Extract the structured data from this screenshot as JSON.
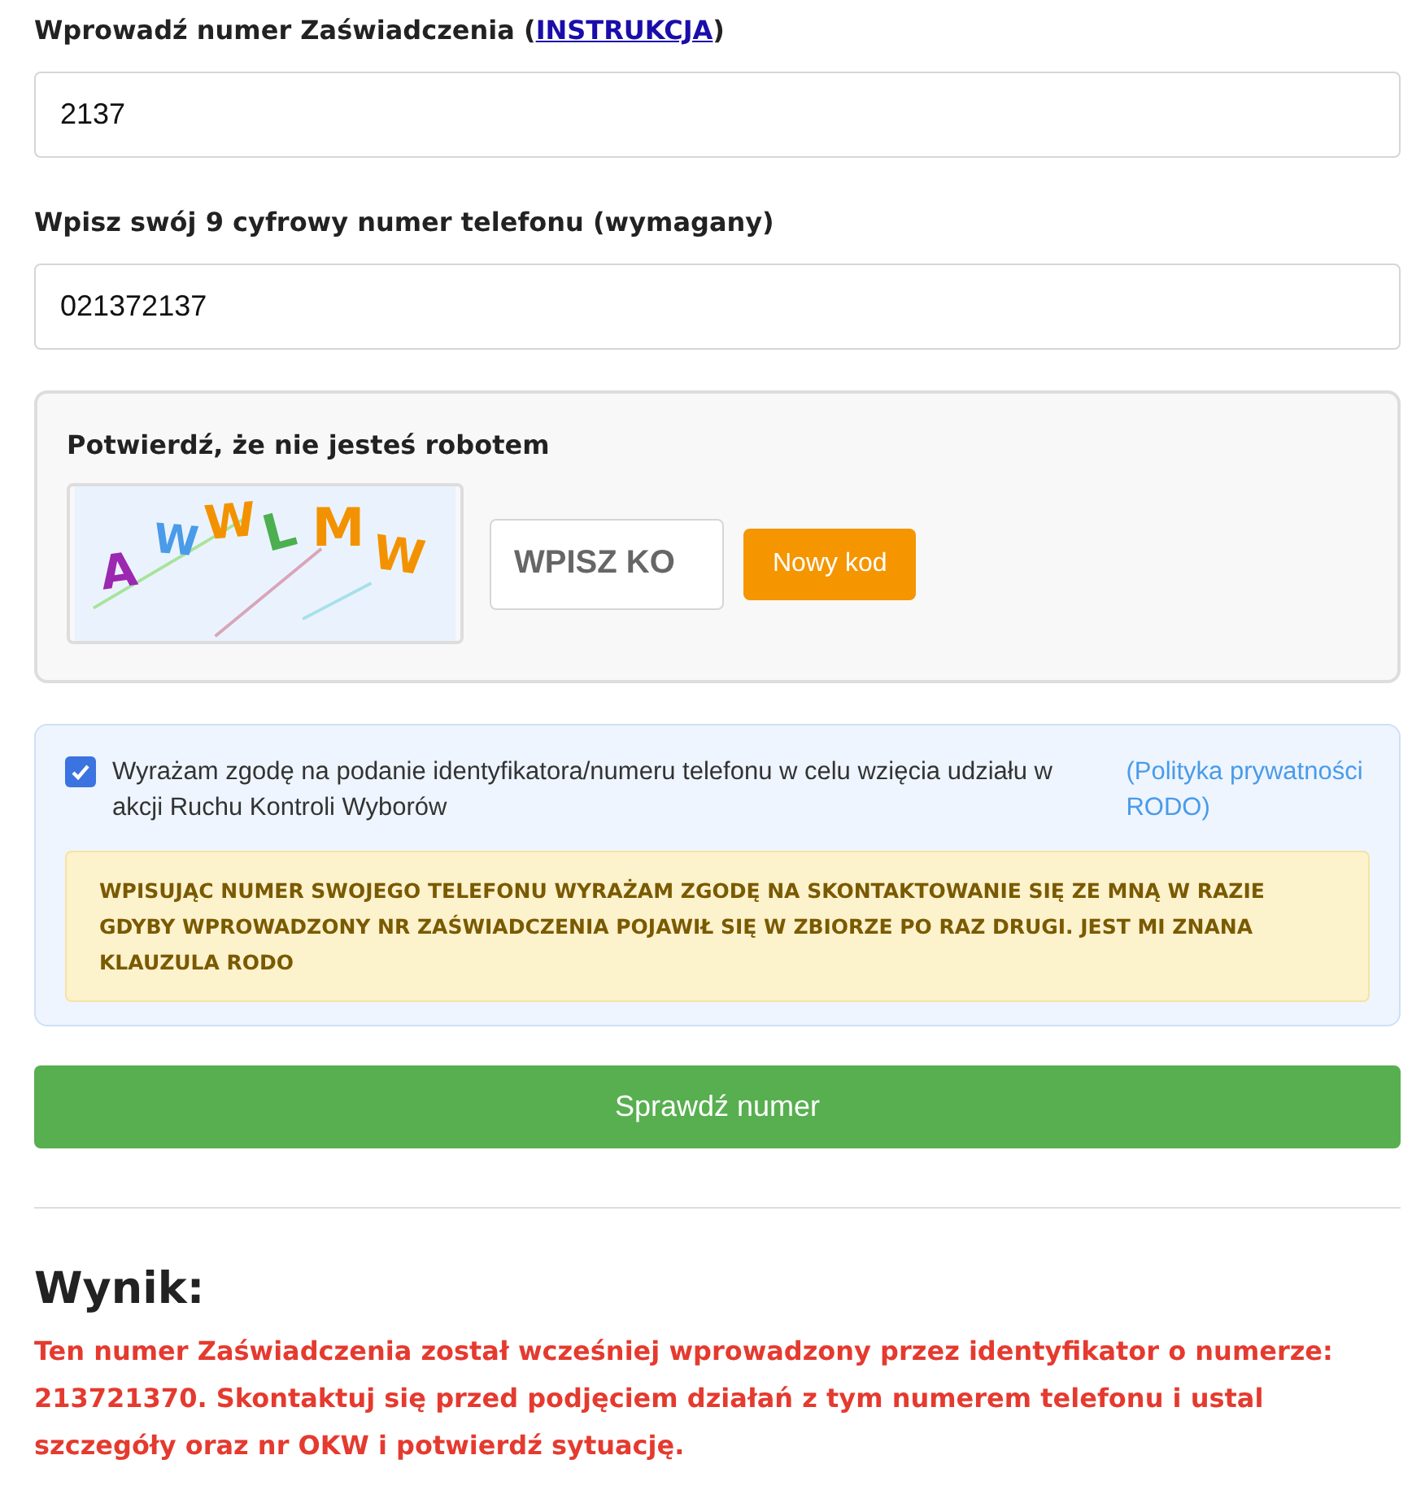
{
  "certificate_field": {
    "label": "Wprowadź numer Zaświadczenia (",
    "link": "INSTRUKCJA",
    "label_end": ")",
    "value": "2137"
  },
  "phone_field": {
    "label": "Wpisz swój 9 cyfrowy numer telefonu (wymagany)",
    "value": "021372137"
  },
  "captcha": {
    "title": "Potwierdź, że nie jesteś robotem",
    "letters": [
      {
        "char": "A",
        "color": "#9c27b0"
      },
      {
        "char": "W",
        "color": "#4a9be8"
      },
      {
        "char": "W",
        "color": "#f39200"
      },
      {
        "char": "L",
        "color": "#4caf50"
      },
      {
        "char": "M",
        "color": "#f39200"
      },
      {
        "char": "W",
        "color": "#f39200"
      }
    ],
    "placeholder": "WPISZ KO",
    "new_code_button": "Nowy kod"
  },
  "consent": {
    "checked": true,
    "text": "Wyrażam zgodę na podanie identyfikatora/numeru telefonu w celu wzięcia udziału w akcji Ruchu Kontroli Wyborów",
    "policy_link": "(Polityka prywatności RODO)",
    "notice": "WPISUJĄC NUMER SWOJEGO TELEFONU WYRAŻAM ZGODĘ NA SKONTAKTOWANIE SIĘ ZE MNĄ W RAZIE GDYBY WPROWADZONY NR ZAŚWIADCZENIA POJAWIŁ SIĘ W ZBIORZE PO RAZ DRUGI. JEST MI ZNANA KLAUZULA RODO"
  },
  "submit_button": "Sprawdź numer",
  "result": {
    "heading": "Wynik:",
    "message": "Ten numer Zaświadczenia został wcześniej wprowadzony przez identyfikator o numerze: 213721370. Skontaktuj się przed podjęciem działań z tym numerem telefonu i ustal szczegóły oraz nr OKW i potwierdź sytuację."
  }
}
